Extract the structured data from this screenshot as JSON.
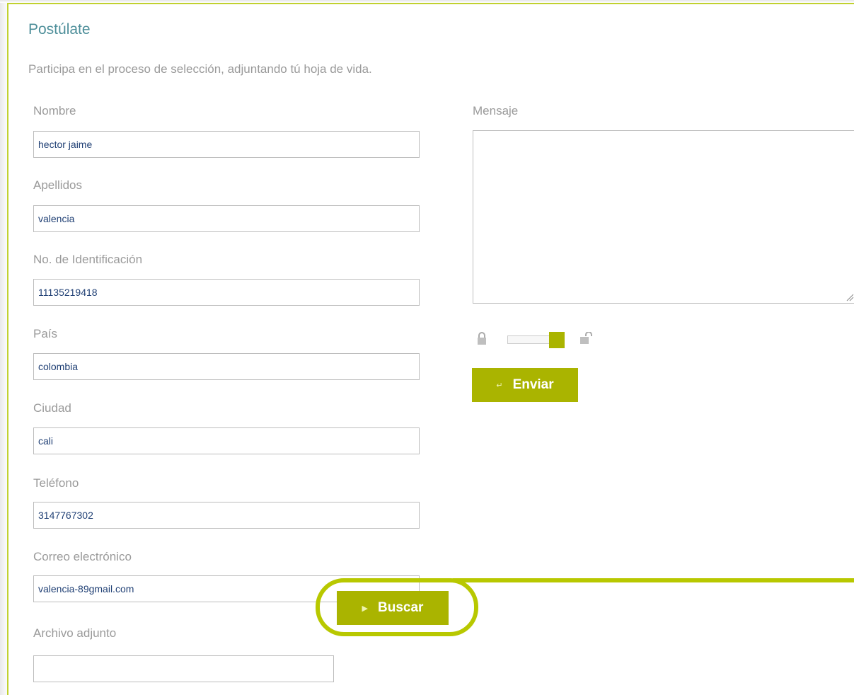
{
  "form": {
    "title": "Postúlate",
    "subtitle": "Participa en el proceso de selección, adjuntando tú hoja de vida.",
    "fields": [
      {
        "label": "Nombre",
        "value": "hector jaime"
      },
      {
        "label": "Apellidos",
        "value": "valencia"
      },
      {
        "label": "No. de Identificación",
        "value": "11135219418"
      },
      {
        "label": "País",
        "value": "colombia"
      },
      {
        "label": "Ciudad",
        "value": "cali"
      },
      {
        "label": "Teléfono",
        "value": "3147767302"
      },
      {
        "label": "Correo electrónico",
        "value": "valencia-89gmail.com"
      }
    ],
    "attachment": {
      "label": "Archivo adjunto",
      "value": "",
      "button_label": "Buscar"
    },
    "message": {
      "label": "Mensaje",
      "value": ""
    },
    "captcha": {
      "lock_icon": "lock-icon",
      "unlock_icon": "unlock-icon",
      "level": 1.0
    },
    "submit_label": "Enviar"
  },
  "colors": {
    "accent": "#aab400",
    "border_accent": "#c1d12f",
    "title": "#4e8f9a",
    "label": "#9a9a9a",
    "field_text": "#1f3f74",
    "highlight": "#b8c800"
  }
}
